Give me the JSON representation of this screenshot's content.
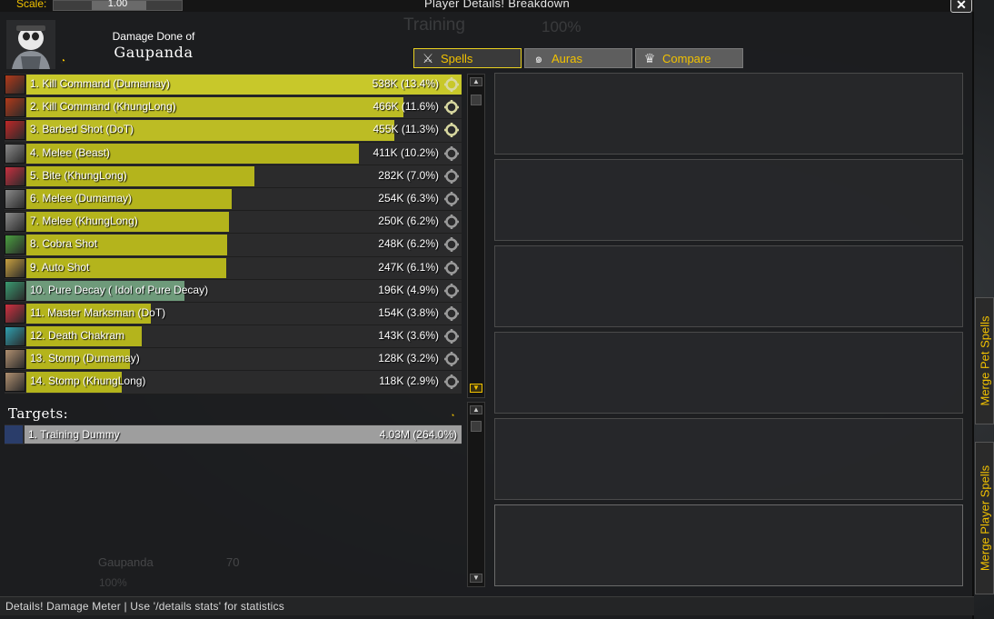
{
  "window": {
    "title": "Player Details! Breakdown",
    "close_label": "✕",
    "scale_label": "Scale:",
    "scale_value": "1.00"
  },
  "header": {
    "caption": "Damage Done of",
    "player_name": "Gaupanda"
  },
  "background_text": {
    "training": "Training",
    "training_pct": "100%",
    "unit_name": "Gaupanda",
    "unit_level": "70",
    "unit_hp_pct": "100%"
  },
  "tabs": [
    {
      "label": "Spells",
      "icon": "crossed-swords-icon",
      "active": true
    },
    {
      "label": "Auras",
      "icon": "swirl-icon",
      "active": false
    },
    {
      "label": "Compare",
      "icon": "crown-icon",
      "active": false
    }
  ],
  "colors": {
    "bar_yellow": "#b4b41c",
    "bar_green": "#6e9a7a",
    "bar_grey": "#9e9e9e",
    "accent": "#f2c200"
  },
  "spells": [
    {
      "name": "1. Kill Command (Dumamay)",
      "amount": "538K (13.4%)",
      "fraction": 1.0,
      "color": "#c8c82a",
      "icon": "kill-command-icon",
      "icon_color": "#b23a1a"
    },
    {
      "name": "2. Kill Command (KhungLong)",
      "amount": "466K (11.6%)",
      "fraction": 0.866,
      "color": "#bcbc24",
      "icon": "kill-command-icon",
      "icon_color": "#b23a1a"
    },
    {
      "name": "3. Barbed Shot (DoT)",
      "amount": "455K (11.3%)",
      "fraction": 0.846,
      "color": "#bcbc24",
      "icon": "barbed-shot-icon",
      "icon_color": "#c02828"
    },
    {
      "name": "4. Melee (Beast)",
      "amount": "411K (10.2%)",
      "fraction": 0.764,
      "color": "#b4b41c",
      "icon": "sword-icon",
      "icon_color": "#8a8a8a"
    },
    {
      "name": "5. Bite (KhungLong)",
      "amount": "282K (7.0%)",
      "fraction": 0.524,
      "color": "#b4b41c",
      "icon": "bite-icon",
      "icon_color": "#c83040"
    },
    {
      "name": "6. Melee (Dumamay)",
      "amount": "254K (6.3%)",
      "fraction": 0.472,
      "color": "#b4b41c",
      "icon": "sword-icon",
      "icon_color": "#8a8a8a"
    },
    {
      "name": "7. Melee (KhungLong)",
      "amount": "250K (6.2%)",
      "fraction": 0.465,
      "color": "#b4b41c",
      "icon": "sword-icon",
      "icon_color": "#8a8a8a"
    },
    {
      "name": "8. Cobra Shot",
      "amount": "248K (6.2%)",
      "fraction": 0.461,
      "color": "#b4b41c",
      "icon": "cobra-shot-icon",
      "icon_color": "#4aa040"
    },
    {
      "name": "9. Auto Shot",
      "amount": "247K (6.1%)",
      "fraction": 0.459,
      "color": "#b4b41c",
      "icon": "auto-shot-icon",
      "icon_color": "#c8a040"
    },
    {
      "name": "10. Pure Decay (  Idol of Pure Decay)",
      "amount": "196K (4.9%)",
      "fraction": 0.364,
      "color": "#6e9a7a",
      "icon": "pure-decay-icon",
      "icon_color": "#3a9a70"
    },
    {
      "name": "11. Master Marksman (DoT)",
      "amount": "154K (3.8%)",
      "fraction": 0.286,
      "color": "#b4b41c",
      "icon": "master-marksman-icon",
      "icon_color": "#d03040"
    },
    {
      "name": "12. Death Chakram",
      "amount": "143K (3.6%)",
      "fraction": 0.266,
      "color": "#b4b41c",
      "icon": "death-chakram-icon",
      "icon_color": "#30a0b0"
    },
    {
      "name": "13. Stomp (Dumamay)",
      "amount": "128K (3.2%)",
      "fraction": 0.238,
      "color": "#b4b41c",
      "icon": "stomp-icon",
      "icon_color": "#b09070"
    },
    {
      "name": "14. Stomp (KhungLong)",
      "amount": "118K (2.9%)",
      "fraction": 0.219,
      "color": "#b4b41c",
      "icon": "stomp-icon",
      "icon_color": "#b09070"
    }
  ],
  "targets": {
    "title": "Targets:",
    "rows": [
      {
        "name": "1. Training Dummy",
        "amount": "4.03M (264.0%)"
      }
    ]
  },
  "side_tabs": {
    "merge_pet": "Merge Pet Spells",
    "merge_player": "Merge Player Spells"
  },
  "status": "Details! Damage Meter | Use '/details stats' for statistics"
}
